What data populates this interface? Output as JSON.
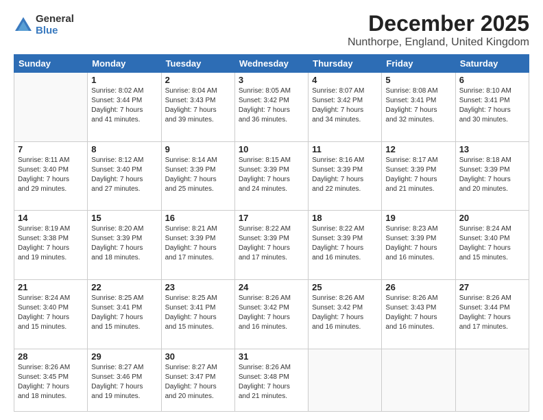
{
  "logo": {
    "general": "General",
    "blue": "Blue"
  },
  "title": "December 2025",
  "subtitle": "Nunthorpe, England, United Kingdom",
  "days_header": [
    "Sunday",
    "Monday",
    "Tuesday",
    "Wednesday",
    "Thursday",
    "Friday",
    "Saturday"
  ],
  "weeks": [
    [
      {
        "day": "",
        "info": ""
      },
      {
        "day": "1",
        "info": "Sunrise: 8:02 AM\nSunset: 3:44 PM\nDaylight: 7 hours\nand 41 minutes."
      },
      {
        "day": "2",
        "info": "Sunrise: 8:04 AM\nSunset: 3:43 PM\nDaylight: 7 hours\nand 39 minutes."
      },
      {
        "day": "3",
        "info": "Sunrise: 8:05 AM\nSunset: 3:42 PM\nDaylight: 7 hours\nand 36 minutes."
      },
      {
        "day": "4",
        "info": "Sunrise: 8:07 AM\nSunset: 3:42 PM\nDaylight: 7 hours\nand 34 minutes."
      },
      {
        "day": "5",
        "info": "Sunrise: 8:08 AM\nSunset: 3:41 PM\nDaylight: 7 hours\nand 32 minutes."
      },
      {
        "day": "6",
        "info": "Sunrise: 8:10 AM\nSunset: 3:41 PM\nDaylight: 7 hours\nand 30 minutes."
      }
    ],
    [
      {
        "day": "7",
        "info": "Sunrise: 8:11 AM\nSunset: 3:40 PM\nDaylight: 7 hours\nand 29 minutes."
      },
      {
        "day": "8",
        "info": "Sunrise: 8:12 AM\nSunset: 3:40 PM\nDaylight: 7 hours\nand 27 minutes."
      },
      {
        "day": "9",
        "info": "Sunrise: 8:14 AM\nSunset: 3:39 PM\nDaylight: 7 hours\nand 25 minutes."
      },
      {
        "day": "10",
        "info": "Sunrise: 8:15 AM\nSunset: 3:39 PM\nDaylight: 7 hours\nand 24 minutes."
      },
      {
        "day": "11",
        "info": "Sunrise: 8:16 AM\nSunset: 3:39 PM\nDaylight: 7 hours\nand 22 minutes."
      },
      {
        "day": "12",
        "info": "Sunrise: 8:17 AM\nSunset: 3:39 PM\nDaylight: 7 hours\nand 21 minutes."
      },
      {
        "day": "13",
        "info": "Sunrise: 8:18 AM\nSunset: 3:39 PM\nDaylight: 7 hours\nand 20 minutes."
      }
    ],
    [
      {
        "day": "14",
        "info": "Sunrise: 8:19 AM\nSunset: 3:38 PM\nDaylight: 7 hours\nand 19 minutes."
      },
      {
        "day": "15",
        "info": "Sunrise: 8:20 AM\nSunset: 3:39 PM\nDaylight: 7 hours\nand 18 minutes."
      },
      {
        "day": "16",
        "info": "Sunrise: 8:21 AM\nSunset: 3:39 PM\nDaylight: 7 hours\nand 17 minutes."
      },
      {
        "day": "17",
        "info": "Sunrise: 8:22 AM\nSunset: 3:39 PM\nDaylight: 7 hours\nand 17 minutes."
      },
      {
        "day": "18",
        "info": "Sunrise: 8:22 AM\nSunset: 3:39 PM\nDaylight: 7 hours\nand 16 minutes."
      },
      {
        "day": "19",
        "info": "Sunrise: 8:23 AM\nSunset: 3:39 PM\nDaylight: 7 hours\nand 16 minutes."
      },
      {
        "day": "20",
        "info": "Sunrise: 8:24 AM\nSunset: 3:40 PM\nDaylight: 7 hours\nand 15 minutes."
      }
    ],
    [
      {
        "day": "21",
        "info": "Sunrise: 8:24 AM\nSunset: 3:40 PM\nDaylight: 7 hours\nand 15 minutes."
      },
      {
        "day": "22",
        "info": "Sunrise: 8:25 AM\nSunset: 3:41 PM\nDaylight: 7 hours\nand 15 minutes."
      },
      {
        "day": "23",
        "info": "Sunrise: 8:25 AM\nSunset: 3:41 PM\nDaylight: 7 hours\nand 15 minutes."
      },
      {
        "day": "24",
        "info": "Sunrise: 8:26 AM\nSunset: 3:42 PM\nDaylight: 7 hours\nand 16 minutes."
      },
      {
        "day": "25",
        "info": "Sunrise: 8:26 AM\nSunset: 3:42 PM\nDaylight: 7 hours\nand 16 minutes."
      },
      {
        "day": "26",
        "info": "Sunrise: 8:26 AM\nSunset: 3:43 PM\nDaylight: 7 hours\nand 16 minutes."
      },
      {
        "day": "27",
        "info": "Sunrise: 8:26 AM\nSunset: 3:44 PM\nDaylight: 7 hours\nand 17 minutes."
      }
    ],
    [
      {
        "day": "28",
        "info": "Sunrise: 8:26 AM\nSunset: 3:45 PM\nDaylight: 7 hours\nand 18 minutes."
      },
      {
        "day": "29",
        "info": "Sunrise: 8:27 AM\nSunset: 3:46 PM\nDaylight: 7 hours\nand 19 minutes."
      },
      {
        "day": "30",
        "info": "Sunrise: 8:27 AM\nSunset: 3:47 PM\nDaylight: 7 hours\nand 20 minutes."
      },
      {
        "day": "31",
        "info": "Sunrise: 8:26 AM\nSunset: 3:48 PM\nDaylight: 7 hours\nand 21 minutes."
      },
      {
        "day": "",
        "info": ""
      },
      {
        "day": "",
        "info": ""
      },
      {
        "day": "",
        "info": ""
      }
    ]
  ]
}
